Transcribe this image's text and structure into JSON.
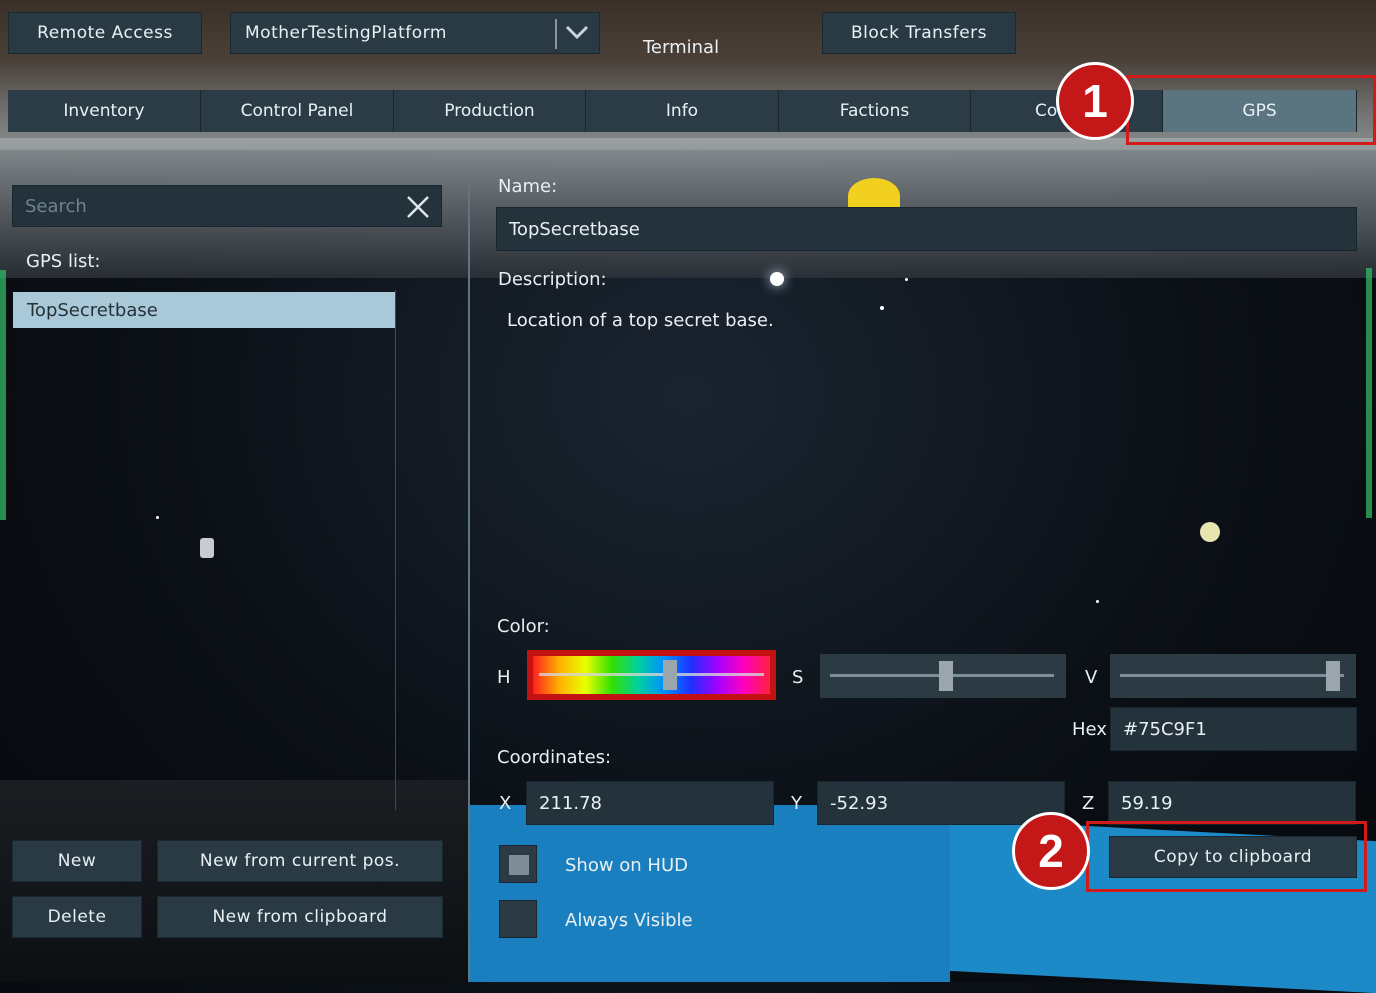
{
  "header": {
    "remote_access": "Remote Access",
    "grid_selector": "MotherTestingPlatform",
    "title": "Terminal",
    "block_transfers": "Block Transfers"
  },
  "tabs": [
    {
      "label": "Inventory"
    },
    {
      "label": "Control Panel"
    },
    {
      "label": "Production"
    },
    {
      "label": "Info"
    },
    {
      "label": "Factions"
    },
    {
      "label": "Co"
    },
    {
      "label": "GPS",
      "active": true
    }
  ],
  "left": {
    "search_placeholder": "Search",
    "gps_list_label": "GPS list:",
    "items": [
      "TopSecretbase"
    ],
    "buttons": {
      "new": "New",
      "new_from_pos": "New from current pos.",
      "delete": "Delete",
      "new_from_clipboard": "New from clipboard"
    }
  },
  "detail": {
    "name_label": "Name:",
    "name_value": "TopSecretbase",
    "description_label": "Description:",
    "description_value": "Location of a top secret base.",
    "color_label": "Color:",
    "h_label": "H",
    "s_label": "S",
    "v_label": "V",
    "h_value": 0.58,
    "s_value": 0.52,
    "v_value": 0.95,
    "hex_label": "Hex",
    "hex_value": "#75C9F1",
    "coordinates_label": "Coordinates:",
    "x_label": "X",
    "x_value": "211.78",
    "y_label": "Y",
    "y_value": "-52.93",
    "z_label": "Z",
    "z_value": "59.19",
    "copy_button": "Copy to clipboard",
    "show_on_hud_label": "Show on HUD",
    "show_on_hud_checked": true,
    "always_visible_label": "Always Visible",
    "always_visible_checked": false
  },
  "annotations": [
    "1",
    "2"
  ],
  "colors": {
    "accent_active_tab": "#5b7580",
    "annotation_red": "#c41717",
    "selected_item": "#a9c9d8"
  }
}
